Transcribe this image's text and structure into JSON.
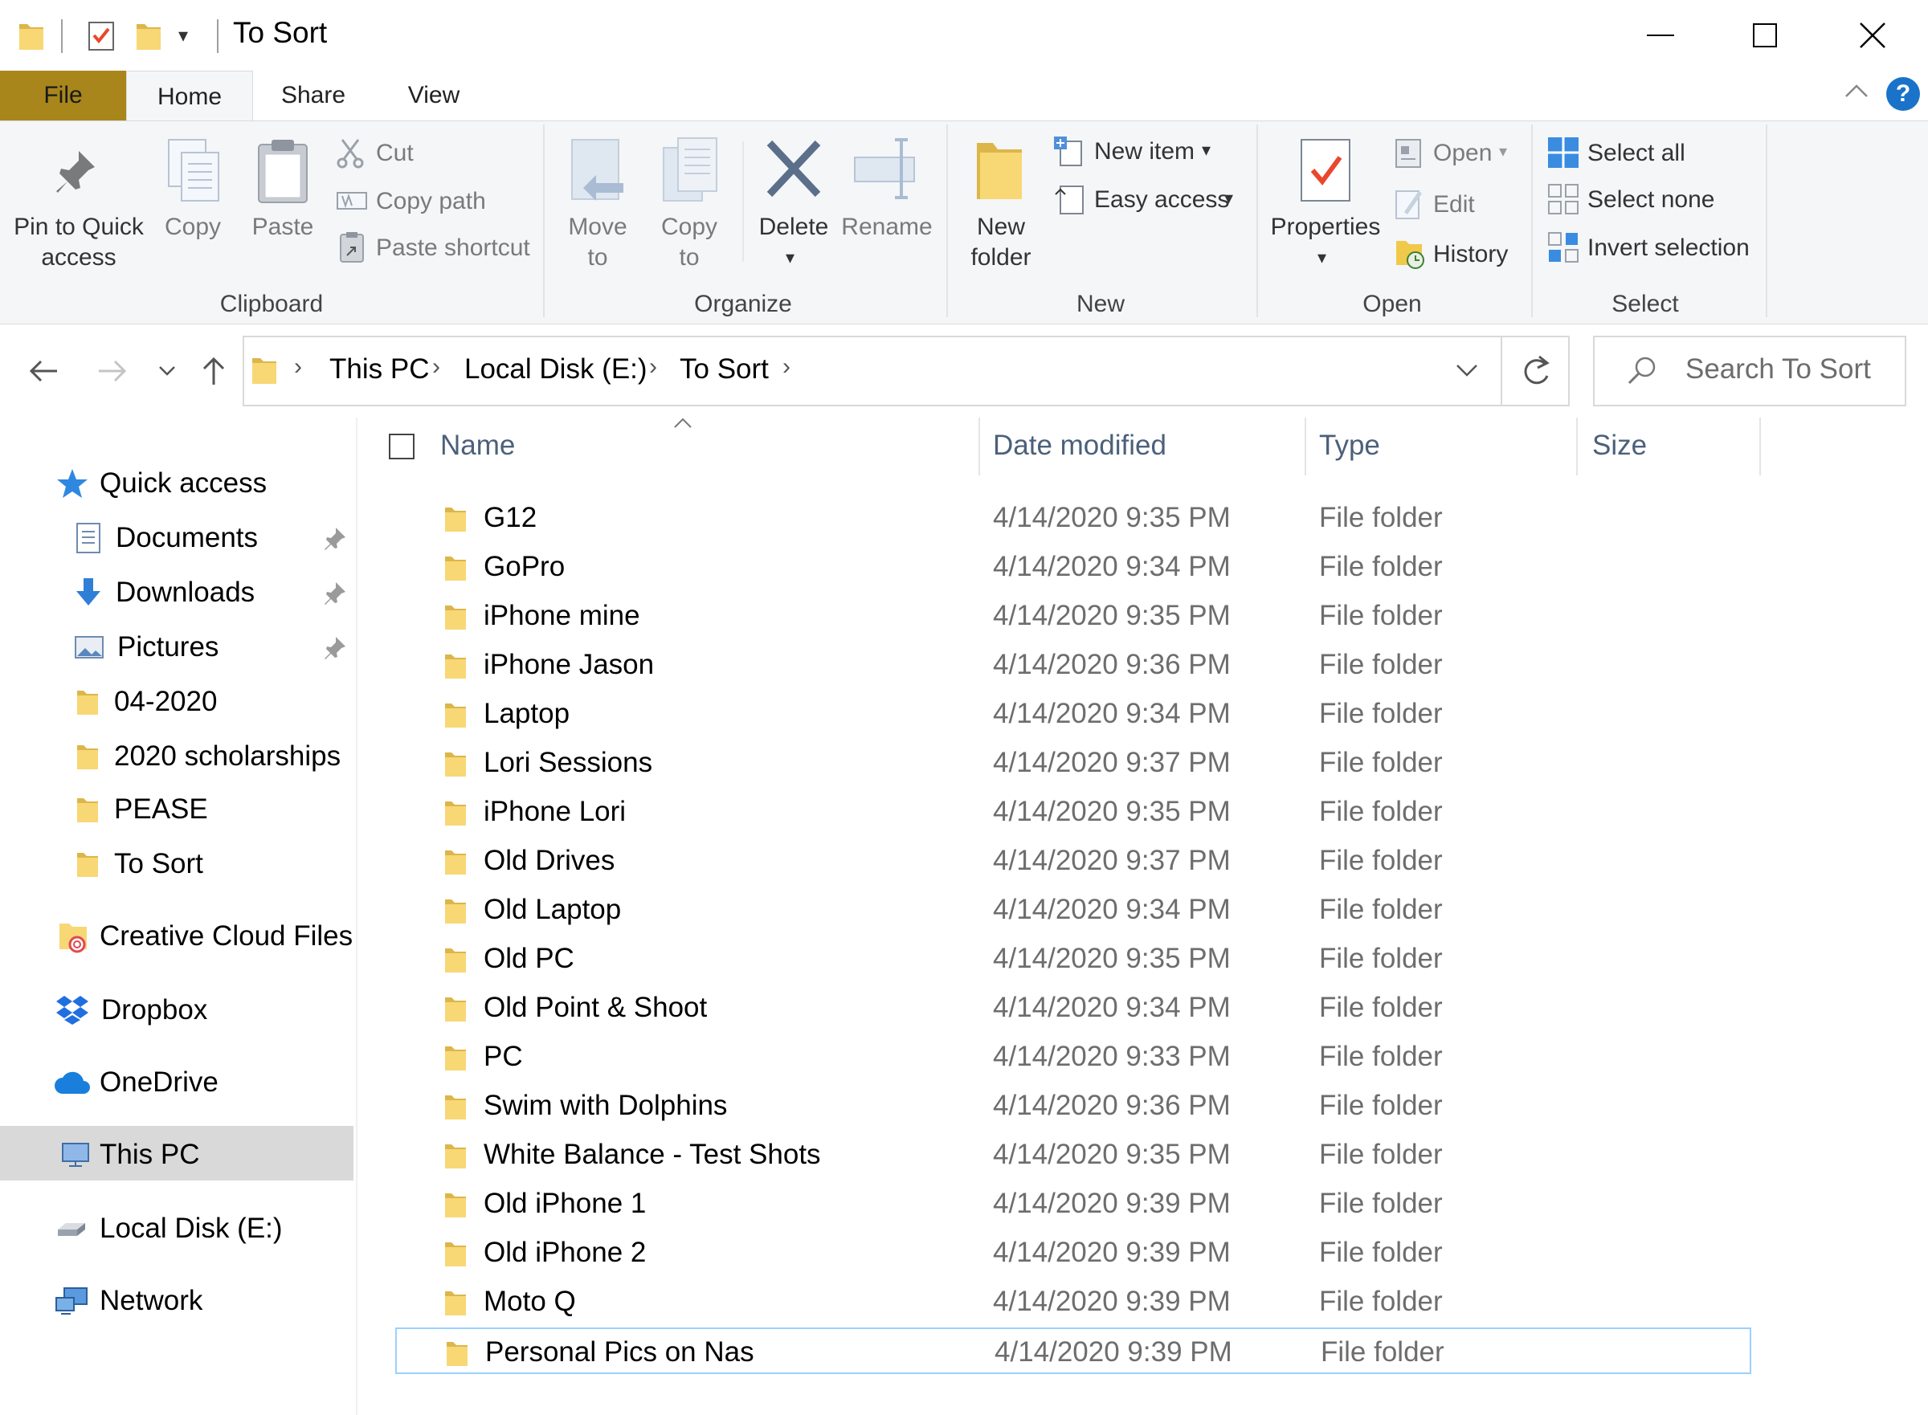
{
  "window": {
    "title": "To Sort",
    "minimize_label": "Minimize",
    "maximize_label": "Maximize",
    "close_label": "Close"
  },
  "ribbon_tabs": [
    "File",
    "Home",
    "Share",
    "View"
  ],
  "help_label": "?",
  "clipboard": {
    "pin_line1": "Pin to Quick",
    "pin_line2": "access",
    "copy": "Copy",
    "paste": "Paste",
    "cut": "Cut",
    "copy_path": "Copy path",
    "paste_shortcut": "Paste shortcut",
    "group": "Clipboard"
  },
  "organize": {
    "move_line1": "Move",
    "move_line2": "to",
    "copy_line1": "Copy",
    "copy_line2": "to",
    "delete": "Delete",
    "rename": "Rename",
    "group": "Organize"
  },
  "new": {
    "new_folder_line1": "New",
    "new_folder_line2": "folder",
    "new_item": "New item",
    "easy_access": "Easy access",
    "group": "New"
  },
  "open": {
    "properties": "Properties",
    "open": "Open",
    "edit": "Edit",
    "history": "History",
    "group": "Open"
  },
  "select": {
    "select_all": "Select all",
    "select_none": "Select none",
    "invert_selection": "Invert selection",
    "group": "Select"
  },
  "address": {
    "crumbs": [
      "This PC",
      "Local Disk (E:)",
      "To Sort"
    ]
  },
  "search": {
    "placeholder": "Search To Sort"
  },
  "nav": {
    "quick_access": "Quick access",
    "pinned": [
      "Documents",
      "Downloads",
      "Pictures"
    ],
    "folders": [
      "04-2020",
      "2020 scholarships",
      "PEASE",
      "To Sort"
    ],
    "creative_cloud": "Creative Cloud Files",
    "dropbox": "Dropbox",
    "onedrive": "OneDrive",
    "this_pc": "This PC",
    "local_disk": "Local Disk (E:)",
    "network": "Network"
  },
  "columns": {
    "name": "Name",
    "date": "Date modified",
    "type": "Type",
    "size": "Size"
  },
  "files": [
    {
      "name": "G12",
      "date": "4/14/2020 9:35 PM",
      "type": "File folder"
    },
    {
      "name": "GoPro",
      "date": "4/14/2020 9:34 PM",
      "type": "File folder"
    },
    {
      "name": "iPhone mine",
      "date": "4/14/2020 9:35 PM",
      "type": "File folder"
    },
    {
      "name": "iPhone Jason",
      "date": "4/14/2020 9:36 PM",
      "type": "File folder"
    },
    {
      "name": "Laptop",
      "date": "4/14/2020 9:34 PM",
      "type": "File folder"
    },
    {
      "name": "Lori Sessions",
      "date": "4/14/2020 9:37 PM",
      "type": "File folder"
    },
    {
      "name": "iPhone Lori",
      "date": "4/14/2020 9:35 PM",
      "type": "File folder"
    },
    {
      "name": "Old Drives",
      "date": "4/14/2020 9:37 PM",
      "type": "File folder"
    },
    {
      "name": "Old Laptop",
      "date": "4/14/2020 9:34 PM",
      "type": "File folder"
    },
    {
      "name": "Old PC",
      "date": "4/14/2020 9:35 PM",
      "type": "File folder"
    },
    {
      "name": "Old Point & Shoot",
      "date": "4/14/2020 9:34 PM",
      "type": "File folder"
    },
    {
      "name": "PC",
      "date": "4/14/2020 9:33 PM",
      "type": "File folder"
    },
    {
      "name": "Swim with Dolphins",
      "date": "4/14/2020 9:36 PM",
      "type": "File folder"
    },
    {
      "name": "White Balance  - Test Shots",
      "date": "4/14/2020 9:35 PM",
      "type": "File folder"
    },
    {
      "name": "Old iPhone 1",
      "date": "4/14/2020 9:39 PM",
      "type": "File folder"
    },
    {
      "name": "Old iPhone 2",
      "date": "4/14/2020 9:39 PM",
      "type": "File folder"
    },
    {
      "name": "Moto Q",
      "date": "4/14/2020 9:39 PM",
      "type": "File folder"
    },
    {
      "name": "Personal Pics on Nas",
      "date": "4/14/2020 9:39 PM",
      "type": "File folder",
      "selected": true
    }
  ],
  "colors": {
    "file_tab": "#a8861c",
    "folder_yellow": "#f8d775",
    "selection_border": "#99d1ff",
    "nav_selected": "#d9d9d9",
    "header_text": "#4c607a"
  }
}
